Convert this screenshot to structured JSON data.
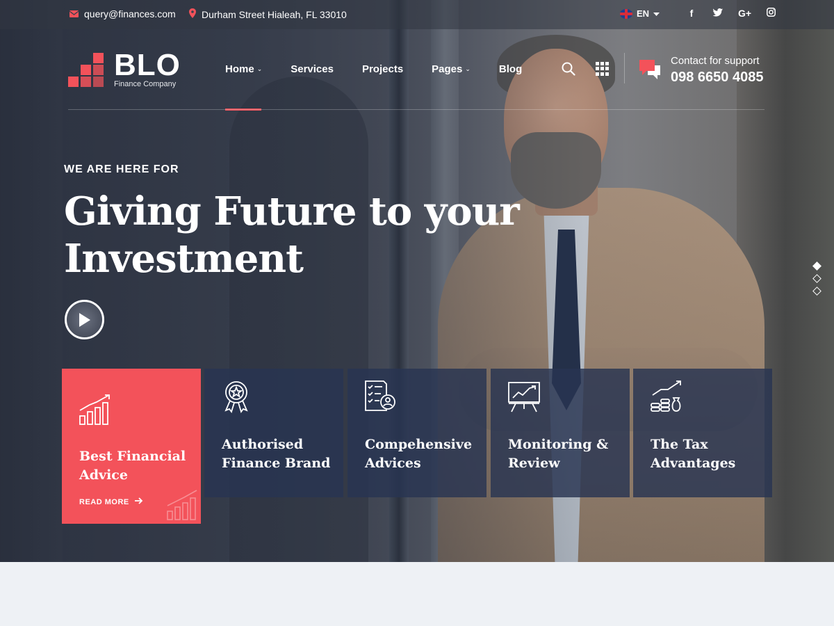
{
  "topbar": {
    "email": "query@finances.com",
    "address": "Durham Street Hialeah, FL 33010",
    "language": "EN",
    "socials": [
      "f",
      "t",
      "G+",
      "ig"
    ]
  },
  "brand": {
    "name": "BLO",
    "tagline": "Finance Company",
    "accent_color": "#f3525a"
  },
  "nav": {
    "items": [
      {
        "label": "Home",
        "dropdown": true,
        "active": true
      },
      {
        "label": "Services",
        "dropdown": false
      },
      {
        "label": "Projects",
        "dropdown": false
      },
      {
        "label": "Pages",
        "dropdown": true
      },
      {
        "label": "Blog",
        "dropdown": false
      }
    ]
  },
  "support": {
    "label": "Contact for support",
    "phone": "098 6650 4085"
  },
  "hero": {
    "eyebrow": "WE ARE HERE FOR",
    "headline": "Giving Future to your Investment",
    "slide_dots": 3,
    "active_slide": 1
  },
  "features": [
    {
      "icon": "growth-chart-icon",
      "title": "Best Financial Advice",
      "cta": "READ MORE",
      "active": true
    },
    {
      "icon": "award-badge-icon",
      "title": "Authorised Finance Brand"
    },
    {
      "icon": "checklist-user-icon",
      "title": "Compehensive Advices"
    },
    {
      "icon": "presentation-board-icon",
      "title": "Monitoring & Review"
    },
    {
      "icon": "coins-growth-icon",
      "title": "The Tax Advantages"
    }
  ]
}
